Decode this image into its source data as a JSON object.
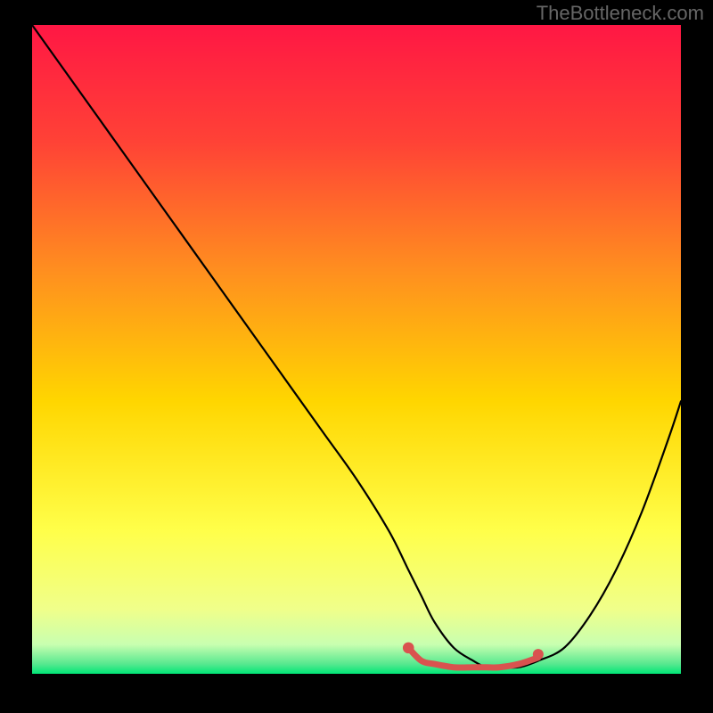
{
  "watermark": "TheBottleneck.com",
  "chart_data": {
    "type": "line",
    "title": "",
    "xlabel": "",
    "ylabel": "",
    "xlim": [
      0,
      100
    ],
    "ylim": [
      0,
      100
    ],
    "legend": false,
    "grid": false,
    "background": {
      "type": "vertical-gradient",
      "stops": [
        {
          "offset": 0.0,
          "color": "#ff1744"
        },
        {
          "offset": 0.18,
          "color": "#ff4236"
        },
        {
          "offset": 0.38,
          "color": "#ff8f1f"
        },
        {
          "offset": 0.58,
          "color": "#ffd600"
        },
        {
          "offset": 0.78,
          "color": "#ffff4a"
        },
        {
          "offset": 0.9,
          "color": "#f0ff8a"
        },
        {
          "offset": 0.955,
          "color": "#c8ffb0"
        },
        {
          "offset": 0.985,
          "color": "#57e88f"
        },
        {
          "offset": 1.0,
          "color": "#00e676"
        }
      ]
    },
    "series": [
      {
        "name": "bottleneck-curve",
        "color": "#000000",
        "stroke_width": 2.2,
        "x": [
          0,
          5,
          10,
          15,
          20,
          25,
          30,
          35,
          40,
          45,
          50,
          55,
          58,
          60,
          62,
          65,
          68,
          70,
          72,
          75,
          78,
          82,
          86,
          90,
          94,
          98,
          100
        ],
        "y": [
          100,
          93,
          86,
          79,
          72,
          65,
          58,
          51,
          44,
          37,
          30,
          22,
          16,
          12,
          8,
          4,
          2,
          1,
          1,
          1,
          2,
          4,
          9,
          16,
          25,
          36,
          42
        ]
      }
    ],
    "highlight_segment": {
      "color": "#d9534f",
      "stroke_width": 7,
      "x": [
        58,
        60,
        62,
        65,
        68,
        70,
        72,
        75,
        78
      ],
      "y": [
        4,
        2,
        1.5,
        1,
        1,
        1,
        1,
        1.5,
        2.5
      ]
    },
    "highlight_point": {
      "color": "#d9534f",
      "radius": 6,
      "x": 78,
      "y": 3
    }
  }
}
